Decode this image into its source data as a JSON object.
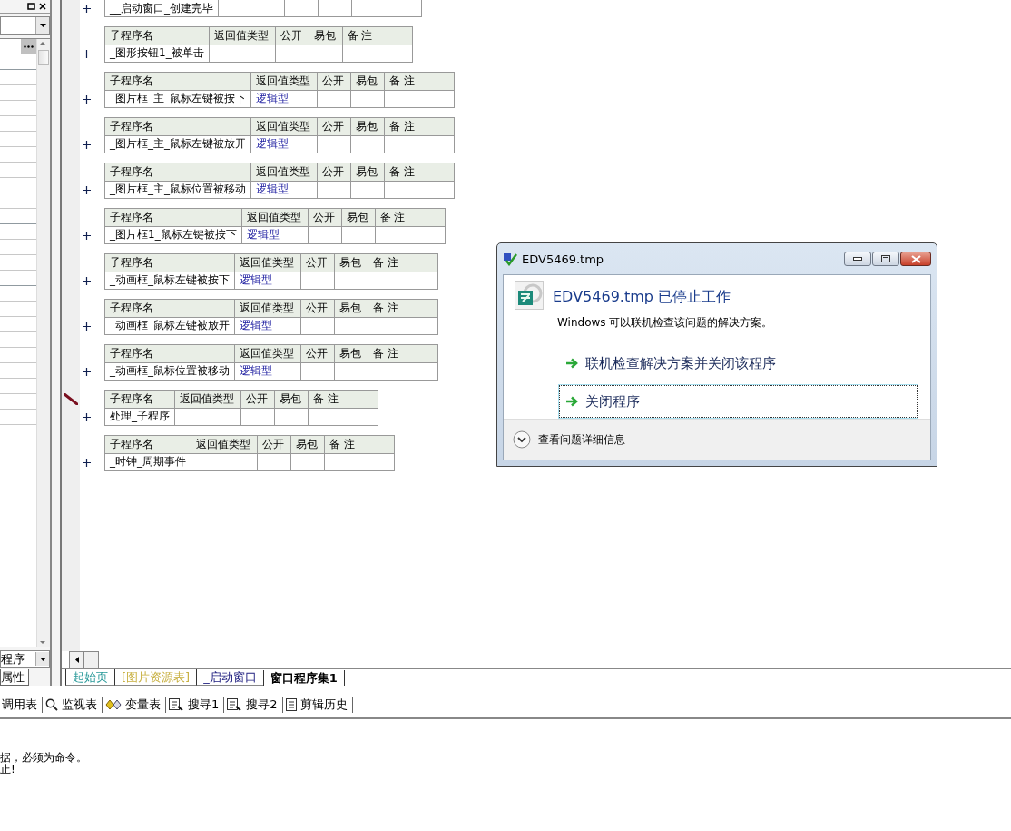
{
  "properties_panel": {
    "selector": "程序",
    "tab": "属性"
  },
  "editor": {
    "tables": [
      {
        "row": {
          "name": "__启动窗口_创建完毕"
        },
        "current": false
      },
      {
        "header": [
          "子程序名",
          "返回值类型",
          "公开",
          "易包",
          "备 注"
        ],
        "row": {
          "name": "_图形按钮1_被单击"
        },
        "current": false
      },
      {
        "header": [
          "子程序名",
          "返回值类型",
          "公开",
          "易包",
          "备 注"
        ],
        "row": {
          "name": "_图片框_主_鼠标左键被按下",
          "return_type": "逻辑型"
        },
        "current": false
      },
      {
        "header": [
          "子程序名",
          "返回值类型",
          "公开",
          "易包",
          "备 注"
        ],
        "row": {
          "name": "_图片框_主_鼠标左键被放开",
          "return_type": "逻辑型"
        },
        "current": false
      },
      {
        "header": [
          "子程序名",
          "返回值类型",
          "公开",
          "易包",
          "备 注"
        ],
        "row": {
          "name": "_图片框_主_鼠标位置被移动",
          "return_type": "逻辑型"
        },
        "current": false
      },
      {
        "header": [
          "子程序名",
          "返回值类型",
          "公开",
          "易包",
          "备 注"
        ],
        "row": {
          "name": "_图片框1_鼠标左键被按下",
          "return_type": "逻辑型"
        },
        "current": false
      },
      {
        "header": [
          "子程序名",
          "返回值类型",
          "公开",
          "易包",
          "备 注"
        ],
        "row": {
          "name": "_动画框_鼠标左键被按下",
          "return_type": "逻辑型"
        },
        "current": false
      },
      {
        "header": [
          "子程序名",
          "返回值类型",
          "公开",
          "易包",
          "备 注"
        ],
        "row": {
          "name": "_动画框_鼠标左键被放开",
          "return_type": "逻辑型"
        },
        "current": false
      },
      {
        "header": [
          "子程序名",
          "返回值类型",
          "公开",
          "易包",
          "备 注"
        ],
        "row": {
          "name": "_动画框_鼠标位置被移动",
          "return_type": "逻辑型"
        },
        "current": false
      },
      {
        "header": [
          "子程序名",
          "返回值类型",
          "公开",
          "易包",
          "备 注"
        ],
        "row": {
          "name": "处理_子程序"
        },
        "current": true
      },
      {
        "header": [
          "子程序名",
          "返回值类型",
          "公开",
          "易包",
          "备 注"
        ],
        "row": {
          "name": "_时钟_周期事件"
        },
        "current": false
      }
    ]
  },
  "editor_tabs": [
    {
      "label": "起始页",
      "color": "#2a9a9a",
      "selected": false
    },
    {
      "label": "[图片资源表]",
      "color": "#c8b040",
      "selected": false
    },
    {
      "label": "_启动窗口",
      "color": "#202080",
      "selected": false
    },
    {
      "label": "窗口程序集1",
      "color": "#000000",
      "selected": true
    }
  ],
  "toolbar": [
    {
      "label": "调用表",
      "kind": "plain"
    },
    {
      "label": "监视表",
      "kind": "watch"
    },
    {
      "label": "变量表",
      "kind": "variables"
    },
    {
      "label": "搜寻1",
      "kind": "find"
    },
    {
      "label": "搜寻2",
      "kind": "find"
    },
    {
      "label": "剪辑历史",
      "kind": "history"
    }
  ],
  "output": [
    "据，必须为命令。",
    "止!"
  ],
  "dialog": {
    "title": "EDV5469.tmp",
    "heading": "EDV5469.tmp 已停止工作",
    "message": "Windows 可以联机检查该问题的解决方案。",
    "options": [
      {
        "label": "联机检查解决方案并关闭该程序",
        "focused": false
      },
      {
        "label": "关闭程序",
        "focused": true
      }
    ],
    "details": "查看问题详细信息"
  }
}
